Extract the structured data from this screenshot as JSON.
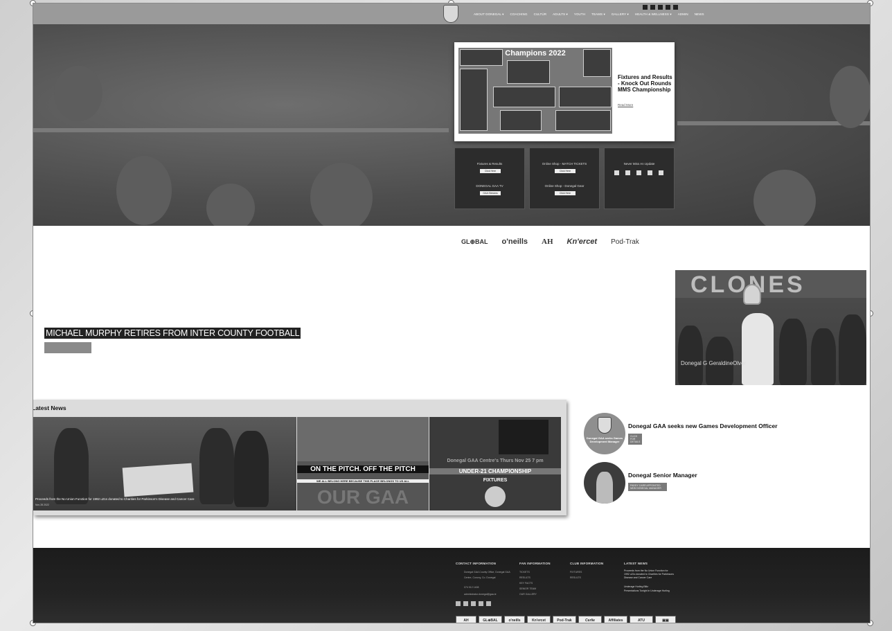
{
  "nav": {
    "items": [
      "ABOUT DONEGAL ▾",
      "COACHING",
      "CULTÚR",
      "ADULTS ▾",
      "YOUTH",
      "TEAMS ▾",
      "GALLERY ▾",
      "HEALTH & WELLNESS ▾",
      "ADMIN",
      "NEWS"
    ],
    "social_icons": [
      "facebook-icon",
      "twitter-icon",
      "instagram-icon",
      "linkedin-icon",
      "youtube-icon"
    ]
  },
  "feature": {
    "collage_title": "Champions 2022",
    "title": "Fixtures and Results - Knock Out Rounds MMS Championship",
    "read_more": "Read More"
  },
  "tiles": [
    {
      "label1": "Fixtures & Results",
      "btn1": "Click Here",
      "label2": "DONEGAL GAA TV",
      "btn2": "GAA Streams"
    },
    {
      "label1": "Online Shop - MATCH TICKETS",
      "btn1": "Click Here",
      "label2": "Online Shop - Donegal Gear",
      "btn2": "Click Here"
    },
    {
      "label1": "Never Miss An Update"
    }
  ],
  "sponsors": [
    "GL⊕BAL",
    "o'neills",
    "AH",
    "Kn'ercet",
    "Pod-Trak"
  ],
  "headline": "MICHAEL MURPHY RETIRES FROM INTER COUNTY FOOTBALL",
  "clones_photo": {
    "wall_text": "CLONES",
    "caption": "Donegal G\nGeraldineOlver"
  },
  "latest_news": {
    "heading": "Latest News",
    "main_caption": "Proceeds from the No Union Function for 1992 u21s donated to Charities for Parkinson's Disease and Cancer Care",
    "main_date": "Nov 28 2022",
    "pitch_line1": "ON THE PITCH. OFF THE PITCH",
    "pitch_line2": "WE ALL BELONG HERE BECAUSE THIS PLACE BELONGS TO US ALL",
    "gaa_text": "OUR GAA",
    "centre_text": "Donegal GAA Centre's Thurs Nov 25 7 pm",
    "u21_text": "UNDER-21 CHAMPIONSHIP",
    "fixtures_text": "FIXTURES"
  },
  "side_news": [
    {
      "title": "Donegal GAA seeks new Games Development Officer",
      "button": "CLICK FOR DETAILS",
      "thumb_text": "Donegal GAA seeks Games Development Manager"
    },
    {
      "title": "Donegal Senior Manager",
      "button": "PADDY CARR APPOINTED NEW DONEGAL MANAGER"
    }
  ],
  "footer": {
    "contact_heading": "CONTACT INFORMATION",
    "address": "Donegal GAA County Office, Donegal GAA Centre, Convoy, Co. Donegal",
    "phone": "074 912 1408",
    "email": "administrator.donegal@gaa.ie",
    "fan_heading": "FAN INFORMATION",
    "fan_items": [
      "TICKETS",
      "RESULTS",
      "KEY FACTS",
      "SENIOR TEAM",
      "OUR GALLERY"
    ],
    "club_heading": "CLUB INFORMATION",
    "club_items": [
      "FIXTURES",
      "RESULTS"
    ],
    "latest_heading": "LATEST NEWS",
    "latest_items": [
      "Proceeds from the No Union Function for 1992 u21s donated to Charities for Parkinsons Disease and Cancer Care",
      "Underage Hurling Blitz",
      "Presentations Tonight in Underage Hurling"
    ],
    "sponsors": [
      "AH",
      "GL⊕BAL",
      "o'neills",
      "Kn'ercet",
      "Pod-Trak",
      "Cerlie",
      "Affiliates",
      "ATU",
      "▣▣"
    ]
  }
}
